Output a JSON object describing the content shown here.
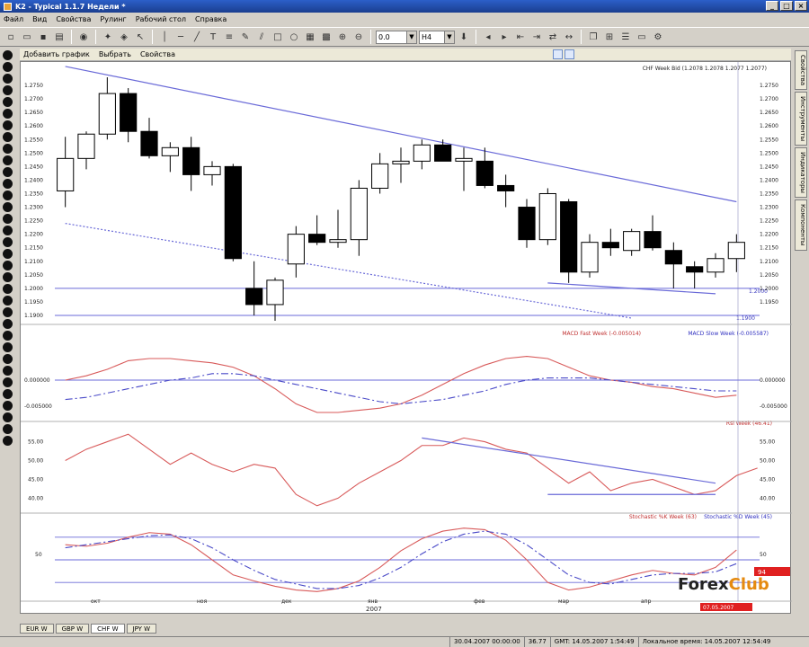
{
  "window": {
    "title": "K2 - Typical 1.1.7 Недели *"
  },
  "menu": [
    "Файл",
    "Вид",
    "Свойства",
    "Рулинг",
    "Рабочий стол",
    "Справка"
  ],
  "toolbar": {
    "combo_step": "0.0",
    "combo_period": "H4"
  },
  "chart_toolbar": {
    "add_chart": "Добавить график",
    "select": "Выбрать",
    "properties": "Свойства"
  },
  "price_panel": {
    "header": "CHF Week Bid (1.2078 1.2078 1.2077 1.2077)",
    "y_ticks": [
      "1.2750",
      "1.2700",
      "1.2650",
      "1.2600",
      "1.2550",
      "1.2500",
      "1.2450",
      "1.2400",
      "1.2350",
      "1.2300",
      "1.2250",
      "1.2200",
      "1.2150",
      "1.2100",
      "1.2050",
      "1.2000",
      "1.1950",
      "1.1900"
    ],
    "level_labels": [
      "1.2000",
      "1.1900"
    ],
    "right_ticks": [
      "1.2750",
      "1.2700",
      "1.2650",
      "1.2600",
      "1.2550",
      "1.2500",
      "1.2450",
      "1.2400",
      "1.2350",
      "1.2300",
      "1.2250",
      "1.2200",
      "1.2150",
      "1.2100",
      "1.2050",
      "1.2000",
      "1.1950"
    ]
  },
  "macd_panel": {
    "legend_fast": "MACD Fast Week (-0.005014)",
    "legend_slow": "MACD Slow Week (-0.005587)",
    "left_ticks": [
      "0.000000",
      "-0.005000"
    ],
    "right_ticks": [
      "0.000000",
      "-0.005000"
    ]
  },
  "rsi_panel": {
    "legend": "Rsi Week (46.41)",
    "left_ticks": [
      "55.00",
      "50.00",
      "45.00",
      "40.00"
    ],
    "right_ticks": [
      "55.00",
      "50.00",
      "45.00",
      "40.00"
    ]
  },
  "stoch_panel": {
    "legend_k": "Stochastic %K Week (63)",
    "legend_d": "Stochastic %D Week (45)",
    "left_tick": "50",
    "right_tick": "50",
    "badge_value": "94",
    "badge_date": "07.05.2007"
  },
  "x_axis": {
    "labels": [
      "окт",
      "ноя",
      "дек",
      "янв",
      "фев",
      "мар",
      "апр"
    ],
    "year": "2007"
  },
  "right_tabs": [
    "Свойства",
    "Инструменты",
    "Индикаторы",
    "Компоненты"
  ],
  "bottom_tabs": [
    "EUR W",
    "GBP W",
    "CHF W",
    "JPY W"
  ],
  "status": {
    "date_range": "30.04.2007 00:00:00",
    "value": "36.77",
    "gmt": "GMT: 14.05.2007 1:54:49",
    "local": "Локальное время: 14.05.2007 12:54:49"
  },
  "watermark": {
    "forex": "Forex",
    "club": "Club"
  },
  "chart_data": {
    "type": "candlestick",
    "candles": [
      {
        "o": 1.236,
        "h": 1.256,
        "l": 1.23,
        "c": 1.248
      },
      {
        "o": 1.248,
        "h": 1.258,
        "l": 1.244,
        "c": 1.257
      },
      {
        "o": 1.257,
        "h": 1.278,
        "l": 1.255,
        "c": 1.272
      },
      {
        "o": 1.272,
        "h": 1.274,
        "l": 1.254,
        "c": 1.258
      },
      {
        "o": 1.258,
        "h": 1.263,
        "l": 1.248,
        "c": 1.249
      },
      {
        "o": 1.249,
        "h": 1.254,
        "l": 1.243,
        "c": 1.252
      },
      {
        "o": 1.252,
        "h": 1.256,
        "l": 1.236,
        "c": 1.242
      },
      {
        "o": 1.242,
        "h": 1.247,
        "l": 1.238,
        "c": 1.245
      },
      {
        "o": 1.245,
        "h": 1.246,
        "l": 1.21,
        "c": 1.211
      },
      {
        "o": 1.2,
        "h": 1.21,
        "l": 1.19,
        "c": 1.194
      },
      {
        "o": 1.194,
        "h": 1.204,
        "l": 1.188,
        "c": 1.203
      },
      {
        "o": 1.209,
        "h": 1.223,
        "l": 1.204,
        "c": 1.22
      },
      {
        "o": 1.22,
        "h": 1.227,
        "l": 1.216,
        "c": 1.217
      },
      {
        "o": 1.217,
        "h": 1.229,
        "l": 1.215,
        "c": 1.218
      },
      {
        "o": 1.218,
        "h": 1.24,
        "l": 1.212,
        "c": 1.237
      },
      {
        "o": 1.237,
        "h": 1.25,
        "l": 1.235,
        "c": 1.246
      },
      {
        "o": 1.246,
        "h": 1.252,
        "l": 1.239,
        "c": 1.247
      },
      {
        "o": 1.247,
        "h": 1.255,
        "l": 1.244,
        "c": 1.253
      },
      {
        "o": 1.253,
        "h": 1.255,
        "l": 1.248,
        "c": 1.247
      },
      {
        "o": 1.247,
        "h": 1.252,
        "l": 1.236,
        "c": 1.248
      },
      {
        "o": 1.247,
        "h": 1.252,
        "l": 1.237,
        "c": 1.238
      },
      {
        "o": 1.238,
        "h": 1.242,
        "l": 1.23,
        "c": 1.236
      },
      {
        "o": 1.23,
        "h": 1.233,
        "l": 1.215,
        "c": 1.218
      },
      {
        "o": 1.218,
        "h": 1.237,
        "l": 1.216,
        "c": 1.235
      },
      {
        "o": 1.232,
        "h": 1.233,
        "l": 1.202,
        "c": 1.206
      },
      {
        "o": 1.206,
        "h": 1.22,
        "l": 1.204,
        "c": 1.217
      },
      {
        "o": 1.217,
        "h": 1.222,
        "l": 1.212,
        "c": 1.215
      },
      {
        "o": 1.214,
        "h": 1.222,
        "l": 1.212,
        "c": 1.221
      },
      {
        "o": 1.221,
        "h": 1.227,
        "l": 1.214,
        "c": 1.215
      },
      {
        "o": 1.214,
        "h": 1.217,
        "l": 1.2,
        "c": 1.209
      },
      {
        "o": 1.208,
        "h": 1.21,
        "l": 1.2,
        "c": 1.206
      },
      {
        "o": 1.206,
        "h": 1.213,
        "l": 1.204,
        "c": 1.211
      },
      {
        "o": 1.211,
        "h": 1.22,
        "l": 1.206,
        "c": 1.217
      }
    ],
    "ylim": [
      1.188,
      1.279
    ],
    "horizontal_levels": [
      1.2,
      1.19
    ],
    "trendlines": [
      {
        "from": [
          0,
          1.282
        ],
        "to": [
          32,
          1.232
        ],
        "style": "solid"
      },
      {
        "from": [
          0,
          1.224
        ],
        "to": [
          27,
          1.189
        ],
        "style": "dotted"
      },
      {
        "from": [
          23,
          1.202
        ],
        "to": [
          31,
          1.198
        ],
        "style": "solid"
      }
    ],
    "macd": {
      "fast": [
        0,
        0.2,
        0.5,
        0.9,
        1,
        1,
        0.9,
        0.8,
        0.6,
        0.2,
        -0.4,
        -1.1,
        -1.5,
        -1.5,
        -1.4,
        -1.3,
        -1.1,
        -0.7,
        -0.2,
        0.3,
        0.7,
        1,
        1.1,
        1,
        0.6,
        0.2,
        0,
        -0.1,
        -0.3,
        -0.4,
        -0.6,
        -0.8,
        -0.7
      ],
      "slow": [
        -0.9,
        -0.8,
        -0.6,
        -0.4,
        -0.2,
        0,
        0.1,
        0.3,
        0.3,
        0.2,
        0,
        -0.2,
        -0.4,
        -0.6,
        -0.8,
        -1,
        -1.1,
        -1,
        -0.9,
        -0.7,
        -0.5,
        -0.2,
        0,
        0.1,
        0.1,
        0.1,
        0,
        -0.1,
        -0.2,
        -0.3,
        -0.4,
        -0.5,
        -0.5
      ],
      "zero_line": 0
    },
    "rsi": {
      "values": [
        50,
        53,
        55,
        57,
        53,
        49,
        52,
        49,
        47,
        49,
        48,
        41,
        38,
        40,
        44,
        47,
        50,
        54,
        54,
        56,
        55,
        53,
        52,
        48,
        44,
        47,
        42,
        44,
        45,
        43,
        41,
        42,
        46,
        48
      ],
      "ylim": [
        37,
        58
      ],
      "trendlines": [
        {
          "from": [
            17,
            56
          ],
          "to": [
            31,
            44
          ]
        },
        {
          "from": [
            23,
            41
          ],
          "to": [
            31,
            41
          ]
        }
      ]
    },
    "stochastic": {
      "k": [
        70,
        68,
        72,
        80,
        86,
        84,
        70,
        50,
        30,
        22,
        15,
        10,
        8,
        12,
        22,
        40,
        62,
        78,
        88,
        92,
        90,
        76,
        50,
        20,
        10,
        14,
        22,
        30,
        36,
        32,
        30,
        40,
        63
      ],
      "d": [
        66,
        70,
        74,
        78,
        82,
        83,
        78,
        66,
        50,
        36,
        24,
        18,
        12,
        12,
        16,
        26,
        40,
        58,
        74,
        84,
        88,
        84,
        70,
        50,
        30,
        20,
        18,
        24,
        30,
        32,
        32,
        34,
        45
      ],
      "levels": [
        80,
        50,
        20
      ]
    }
  }
}
